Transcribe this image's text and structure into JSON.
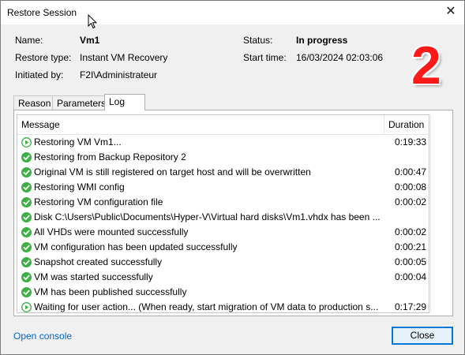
{
  "window": {
    "title": "Restore Session"
  },
  "info": {
    "name_label": "Name:",
    "name_value": "Vm1",
    "type_label": "Restore type:",
    "type_value": "Instant VM Recovery",
    "by_label": "Initiated by:",
    "by_value": "F2I\\Administrateur",
    "status_label": "Status:",
    "status_value": "In progress",
    "start_label": "Start time:",
    "start_value": "16/03/2024 02:03:06"
  },
  "badge": "2",
  "tabs": [
    {
      "label": "Reason",
      "active": false
    },
    {
      "label": "Parameters",
      "active": false
    },
    {
      "label": "Log",
      "active": true
    }
  ],
  "log": {
    "columns": {
      "message": "Message",
      "duration": "Duration"
    },
    "rows": [
      {
        "icon": "play-icon",
        "message": "Restoring VM Vm1...",
        "duration": "0:19:33"
      },
      {
        "icon": "check-icon",
        "message": "Restoring from Backup Repository 2",
        "duration": ""
      },
      {
        "icon": "check-icon",
        "message": "Original VM is still registered on target host and will be overwritten",
        "duration": "0:00:47"
      },
      {
        "icon": "check-icon",
        "message": "Restoring WMI config",
        "duration": "0:00:08"
      },
      {
        "icon": "check-icon",
        "message": "Restoring VM configuration file",
        "duration": "0:00:02"
      },
      {
        "icon": "check-icon",
        "message": "Disk C:\\Users\\Public\\Documents\\Hyper-V\\Virtual hard disks\\Vm1.vhdx has been ...",
        "duration": ""
      },
      {
        "icon": "check-icon",
        "message": "All VHDs were mounted successfully",
        "duration": "0:00:02"
      },
      {
        "icon": "check-icon",
        "message": "VM configuration has been updated successfully",
        "duration": "0:00:21"
      },
      {
        "icon": "check-icon",
        "message": "Snapshot created successfully",
        "duration": "0:00:05"
      },
      {
        "icon": "check-icon",
        "message": "VM was started successfully",
        "duration": "0:00:04"
      },
      {
        "icon": "check-icon",
        "message": "VM has been published successfully",
        "duration": ""
      },
      {
        "icon": "play-icon",
        "message": "Waiting for user action... (When ready, start migration of VM data to production s...",
        "duration": "0:17:29"
      }
    ]
  },
  "footer": {
    "link": "Open console",
    "close_button": "Close"
  },
  "colors": {
    "success": "#3cb043",
    "accent": "#0078d7",
    "link": "#0066cc",
    "badge": "#ff1a1a"
  }
}
